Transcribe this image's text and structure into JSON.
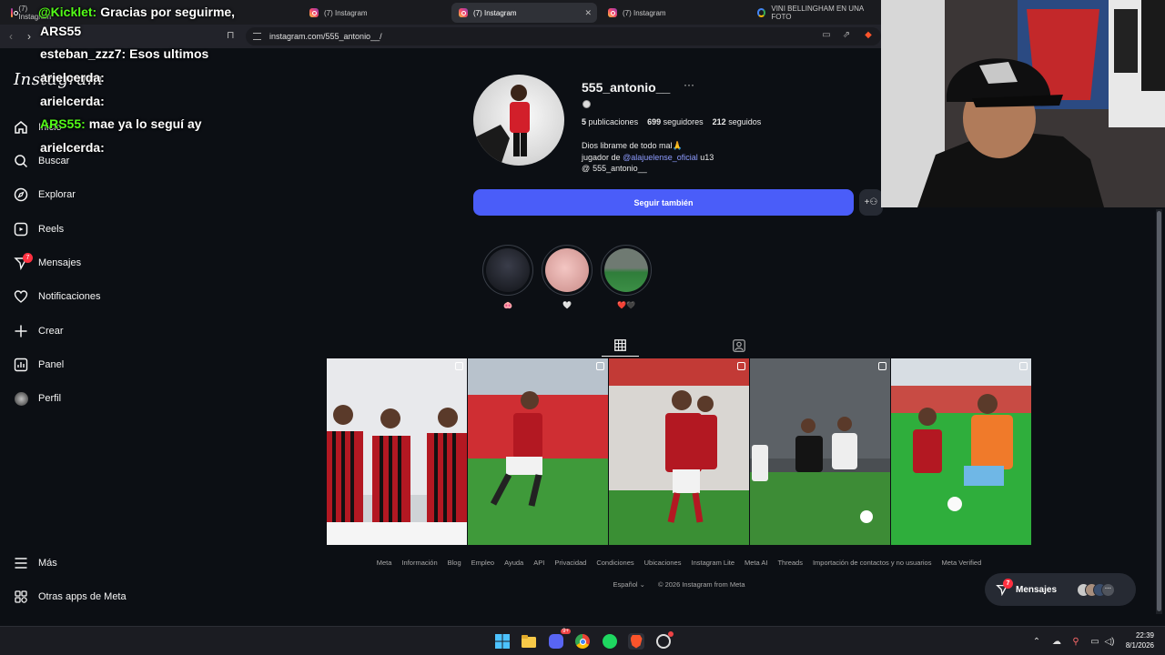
{
  "browser": {
    "tabs": [
      {
        "label": "(7) Instagram"
      },
      {
        "label": "(7) Instagram"
      },
      {
        "label": "(7) Instagram"
      },
      {
        "label": "(7) Instagram"
      },
      {
        "label": "VINI BELLINGHAM EN UNA FOTO"
      }
    ],
    "url": "instagram.com/555_antonio__/"
  },
  "instagram": {
    "logo": "Instagram",
    "nav": [
      {
        "label": "Inicio",
        "icon": "home-icon"
      },
      {
        "label": "Buscar",
        "icon": "search-icon"
      },
      {
        "label": "Explorar",
        "icon": "compass-icon"
      },
      {
        "label": "Reels",
        "icon": "reels-icon"
      },
      {
        "label": "Mensajes",
        "icon": "messenger-icon",
        "badge": "7"
      },
      {
        "label": "Notificaciones",
        "icon": "heart-icon"
      },
      {
        "label": "Crear",
        "icon": "plus-icon"
      },
      {
        "label": "Panel",
        "icon": "chart-icon"
      },
      {
        "label": "Perfil",
        "icon": "avatar-icon"
      }
    ],
    "more": "Más",
    "meta_apps": "Otras apps de Meta",
    "profile": {
      "username": "555_antonio__",
      "menu_glyph": "···",
      "posts_count": "5",
      "posts_label": "publicaciones",
      "followers_count": "699",
      "followers_label": "seguidores",
      "following_count": "212",
      "following_label": "seguidos",
      "bio_line1": "Dios librame de todo mal🙏",
      "bio_line2_prefix": "jugador de",
      "bio_mention": "@alajuelense_oficial",
      "bio_line2_suffix": "u13",
      "threads_handle": "555_antonio__",
      "follow_button": "Seguir también",
      "highlights": [
        {
          "label": "🐽"
        },
        {
          "label": "🤍"
        },
        {
          "label": "❤️🖤"
        }
      ]
    },
    "footer_links": [
      "Meta",
      "Información",
      "Blog",
      "Empleo",
      "Ayuda",
      "API",
      "Privacidad",
      "Condiciones",
      "Ubicaciones",
      "Instagram Lite",
      "Meta AI",
      "Threads",
      "Importación de contactos y no usuarios",
      "Meta Verified"
    ],
    "language": "Español",
    "copyright": "© 2026 Instagram from Meta",
    "messages_pill": {
      "label": "Mensajes",
      "badge": "7"
    }
  },
  "stream": {
    "chat": [
      {
        "user": "@Kicklet:",
        "text": "Gracias por seguirme,",
        "color": "#53fc18"
      },
      {
        "user": "ARS55",
        "text": "",
        "color": "#ffffff"
      },
      {
        "user": "esteban_zzz7:",
        "text": "Esos ultimos",
        "color": "#ffffff"
      },
      {
        "user": "arielcerda:",
        "text": "",
        "color": "#ffffff"
      },
      {
        "user": "arielcerda:",
        "text": "",
        "color": "#ffffff"
      },
      {
        "user": "ARS55:",
        "text": "mae ya lo seguí ay",
        "color": "#53fc18"
      },
      {
        "user": "arielcerda:",
        "text": "",
        "color": "#ffffff"
      }
    ]
  },
  "taskbar": {
    "time": "22:39",
    "date": "8/1/2026",
    "discord_badge": "9+"
  }
}
